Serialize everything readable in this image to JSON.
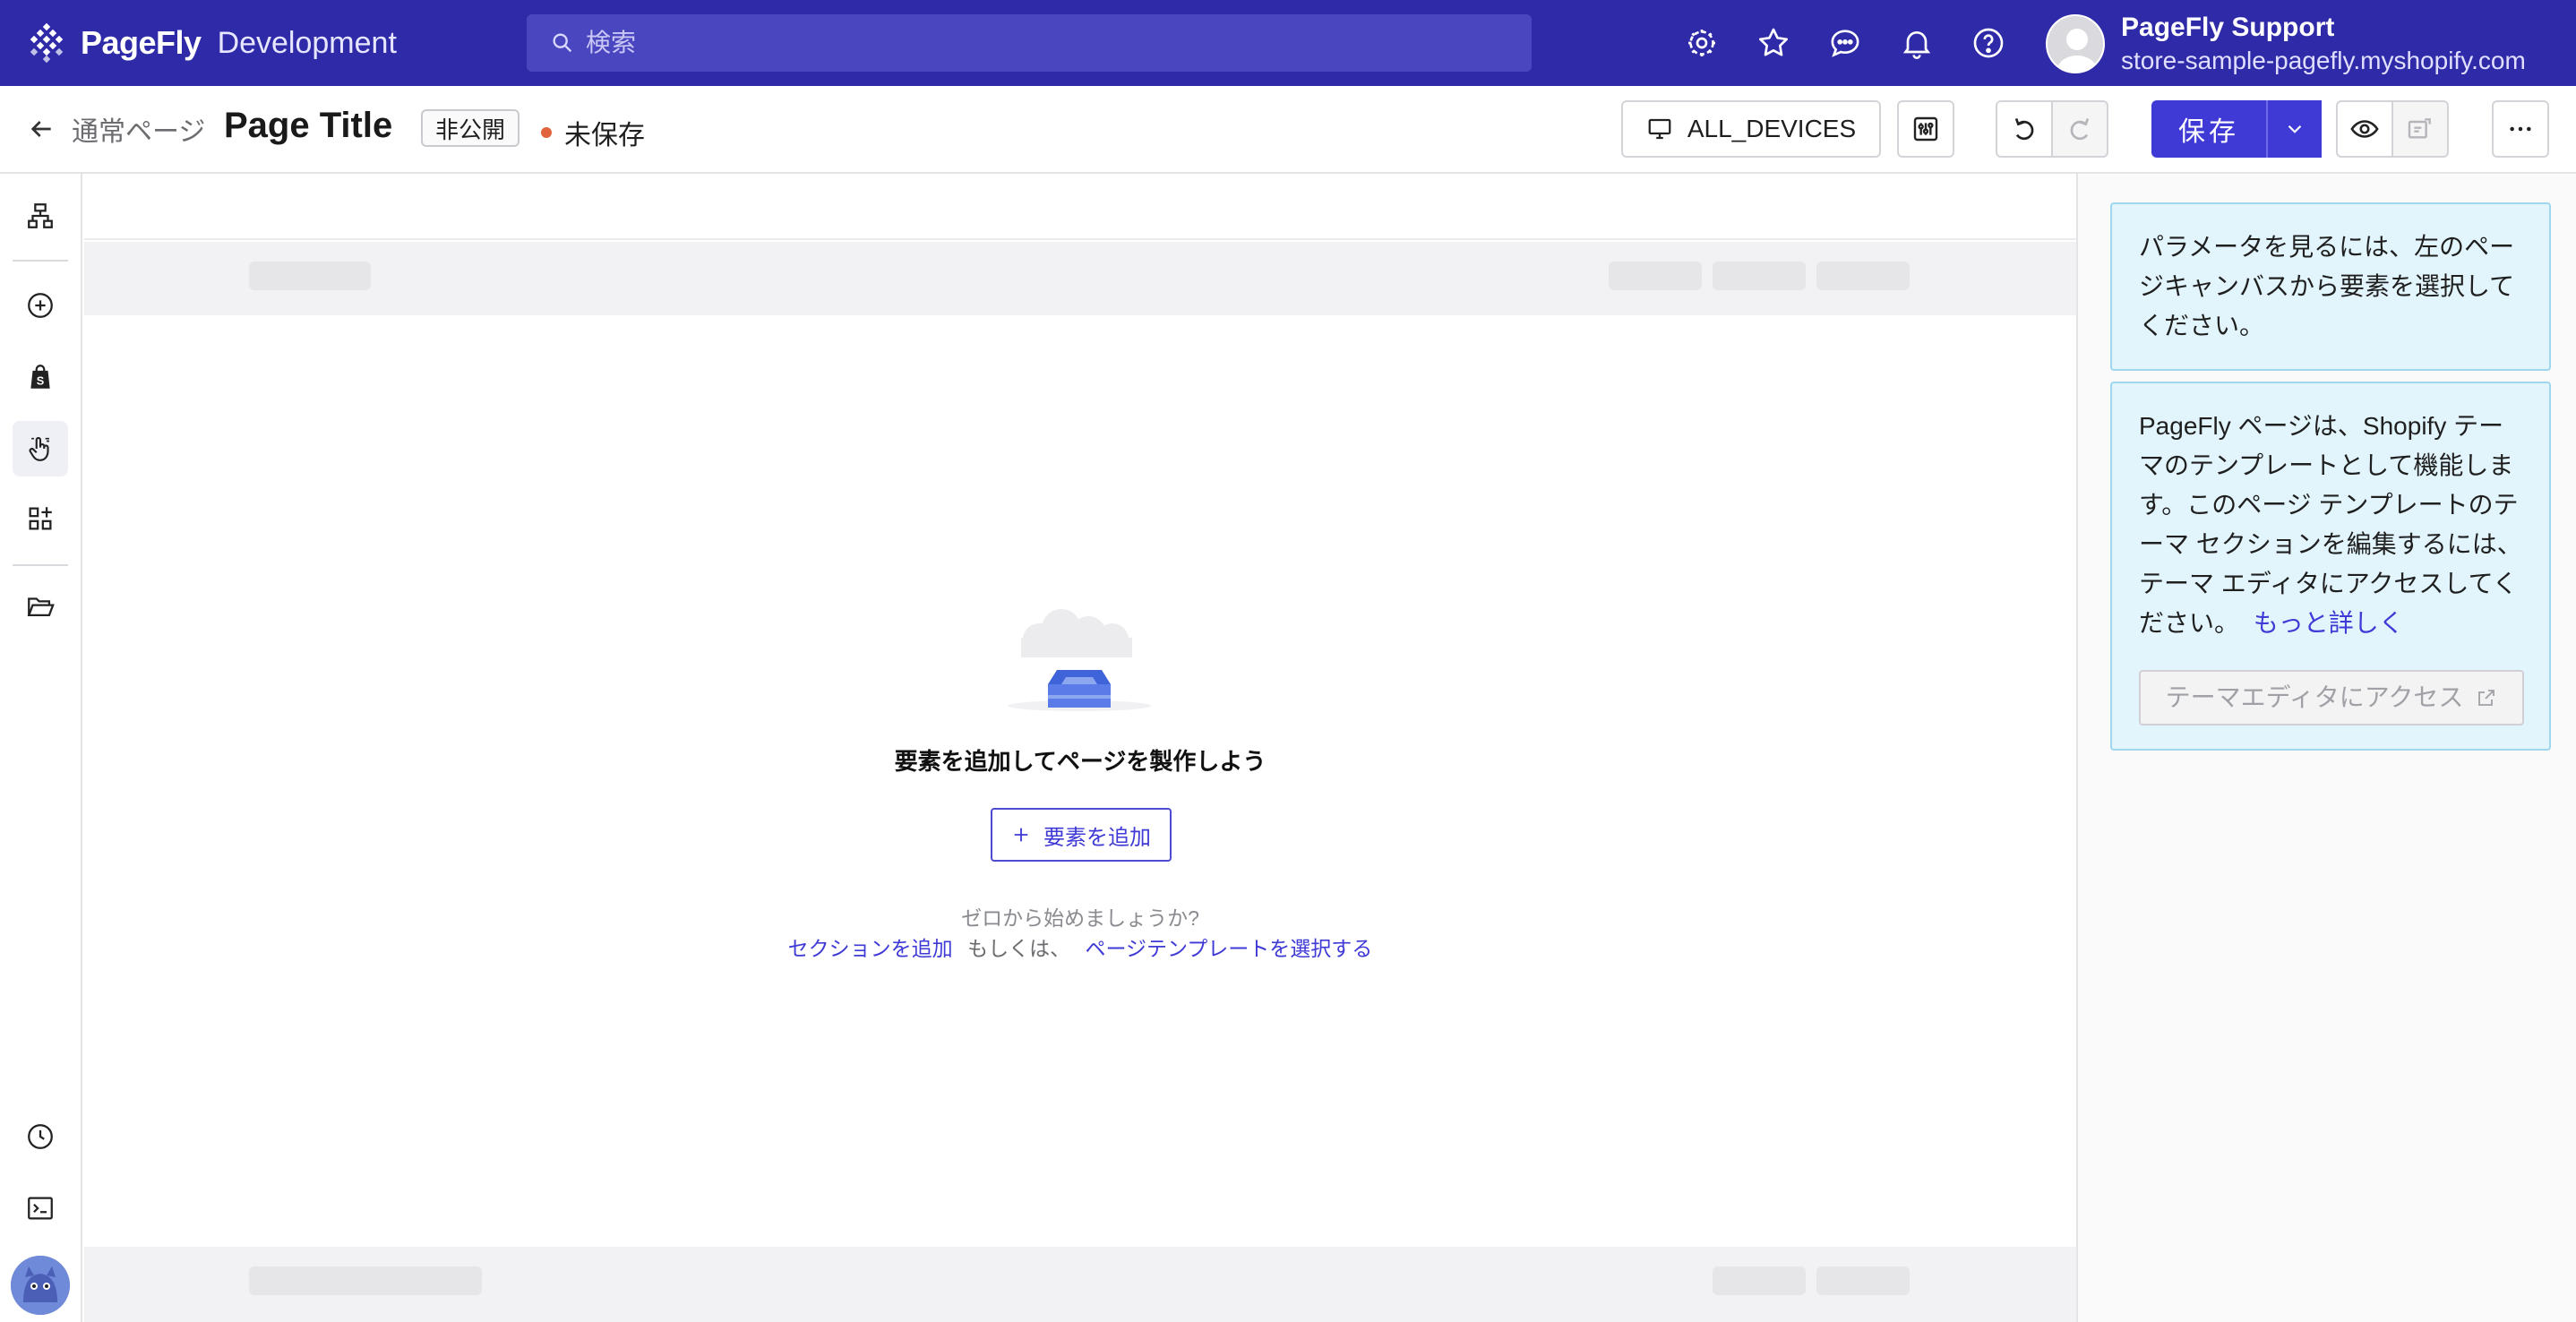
{
  "app": {
    "brand_name": "PageFly",
    "environment": "Development"
  },
  "search": {
    "placeholder": "検索"
  },
  "topbar": {
    "icons": [
      "settings-icon",
      "star-icon",
      "chat-icon",
      "bell-icon",
      "help-icon"
    ]
  },
  "user": {
    "name": "PageFly Support",
    "store": "store-sample-pagefly.myshopify.com"
  },
  "header": {
    "back_label": "通常ページ",
    "page_title": "Page Title",
    "status_badge": "非公開",
    "save_state": "未保存",
    "devices_label": "ALL_DEVICES",
    "save_label": "保存"
  },
  "rail": {
    "items": [
      "sitemap-icon",
      "add-circle-icon",
      "shopify-bag-icon",
      "hand-pointer-icon",
      "widgets-icon",
      "folder-open-icon"
    ],
    "bottom_items": [
      "history-icon",
      "terminal-icon"
    ]
  },
  "canvas": {
    "empty_title": "要素を追加してページを製作しよう",
    "add_button": "要素を追加",
    "hint": "ゼロから始めましょうか?",
    "link_add_section": "セクションを追加",
    "or_text": "もしくは、",
    "link_select_template": "ページテンプレートを選択する"
  },
  "panel": {
    "select_hint": "パラメータを見るには、左のページキャンバスから要素を選択してください。",
    "theme_info": "PageFly ページは、Shopify テーマのテンプレートとして機能します。このページ テンプレートのテーマ セクションを編集するには、テーマ エディタにアクセスしてください。",
    "learn_more": "もっと詳しく",
    "theme_button": "テーマエディタにアクセス"
  },
  "colors": {
    "topbar": "#2e2aa8",
    "accent": "#3f3ad6",
    "unsaved_dot": "#e2643c",
    "info_bg": "#e3f5fc"
  }
}
